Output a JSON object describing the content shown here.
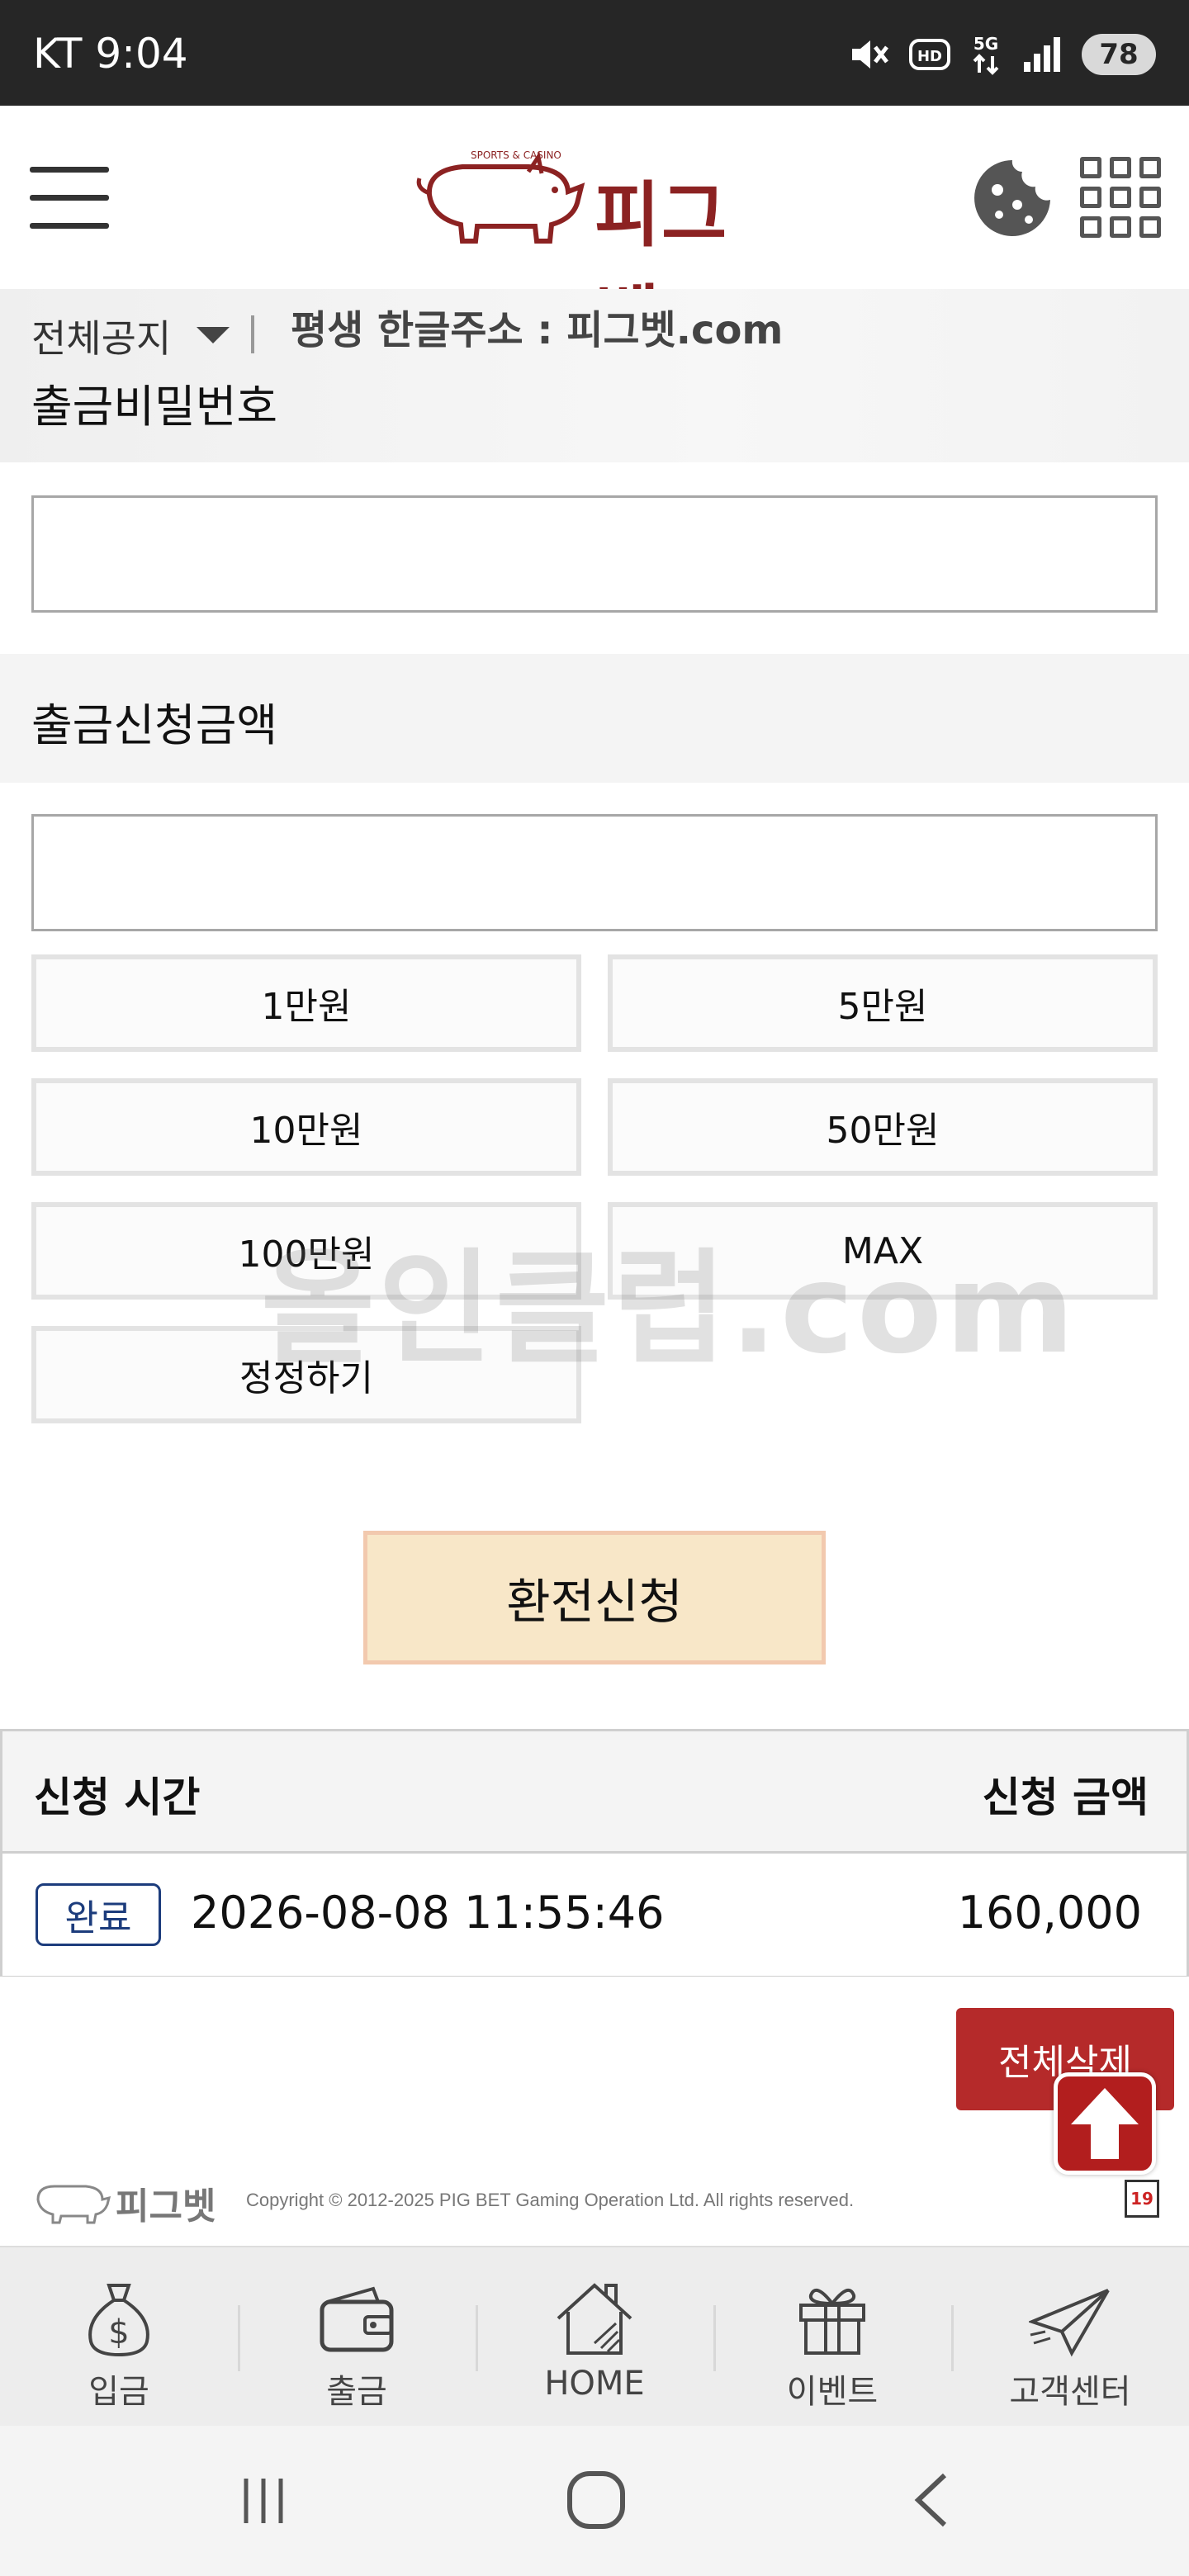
{
  "status_bar": {
    "carrier_time": "KT 9:04",
    "battery": "78",
    "icons": [
      "mute-icon",
      "hd-icon",
      "5g-icon",
      "signal-icon"
    ]
  },
  "header": {
    "logo_text": "피그벳",
    "icons": [
      "menu-icon",
      "cookie-icon",
      "grid-icon"
    ]
  },
  "notice": {
    "label": "전체공지",
    "text": "평생 한글주소 : 피그벳.com"
  },
  "form": {
    "password_label": "출금비밀번호",
    "password_value": "",
    "amount_label": "출금신청금액",
    "amount_value": "",
    "quick_amounts": [
      "1만원",
      "5만원",
      "10만원",
      "50만원",
      "100만원",
      "MAX",
      "정정하기"
    ],
    "submit_label": "환전신청"
  },
  "watermark": "올인클럽.com",
  "history": {
    "col_time": "신청 시간",
    "col_amount": "신청 금액",
    "rows": [
      {
        "status": "완료",
        "time": "2026-08-08 11:55:46",
        "amount": "160,000"
      }
    ],
    "delete_all_label": "전체삭제"
  },
  "footer": {
    "logo_text": "피그벳",
    "copyright": "Copyright © 2012-2025 PIG BET Gaming Operation Ltd. All rights reserved.",
    "age_badge": "19"
  },
  "bottom_nav": [
    {
      "label": "입금",
      "icon": "money-bag-icon"
    },
    {
      "label": "출금",
      "icon": "wallet-icon"
    },
    {
      "label": "HOME",
      "icon": "home-icon"
    },
    {
      "label": "이벤트",
      "icon": "gift-icon"
    },
    {
      "label": "고객센터",
      "icon": "paper-plane-icon"
    }
  ],
  "colors": {
    "brand": "#8c2222",
    "submit_bg": "#f8e7c8",
    "delete_bg": "#b52a2a",
    "badge": "#1c3c7c"
  }
}
